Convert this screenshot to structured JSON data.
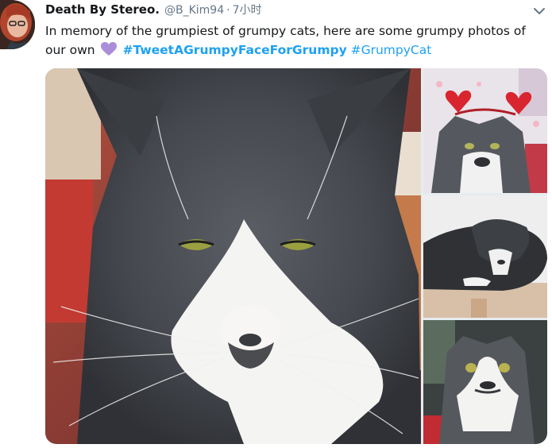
{
  "tweet": {
    "display_name": "Death By Stereo.",
    "handle": "@B_Kim94",
    "separator": "·",
    "timestamp": "7小时",
    "text_before": "In memory of the grumpiest of grumpy cats, here are some grumpy photos of our own",
    "emoji": "purple-heart-emoji",
    "hashtag_primary": "#TweetAGrumpyFaceForGrumpy",
    "hashtag_secondary": "#GrumpyCat",
    "colors": {
      "hashtag": "#1da1f2",
      "secondary_text": "#657786",
      "primary_text": "#14171a",
      "emoji": "#ab8ed9"
    }
  },
  "media": {
    "photos": [
      {
        "name": "grumpy-cat-closeup-photo"
      },
      {
        "name": "cat-with-heart-headband-photo"
      },
      {
        "name": "cat-lying-on-cat-tree-photo"
      },
      {
        "name": "cat-sitting-looking-up-photo"
      }
    ]
  },
  "icons": {
    "caret": "chevron-down-icon",
    "avatar": "user-avatar"
  }
}
